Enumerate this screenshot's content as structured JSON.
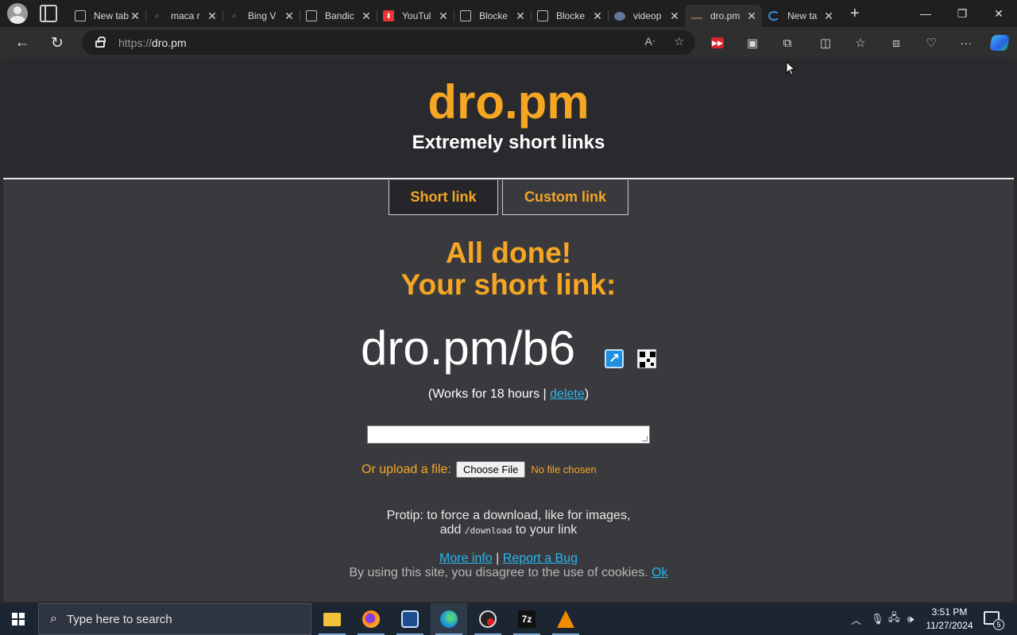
{
  "browser": {
    "tabs": [
      {
        "title": "New tab",
        "favicon": "doc-icon"
      },
      {
        "title": "maca r",
        "favicon": "search-icon"
      },
      {
        "title": "Bing V",
        "favicon": "search-icon"
      },
      {
        "title": "Bandic",
        "favicon": "doc-icon"
      },
      {
        "title": "YouTul",
        "favicon": "youtube-download-icon"
      },
      {
        "title": "Blocke",
        "favicon": "doc-icon"
      },
      {
        "title": "Blocke",
        "favicon": "doc-icon"
      },
      {
        "title": "videop",
        "favicon": "globe-icon"
      },
      {
        "title": "dro.pm",
        "favicon": "dro-icon",
        "active": true
      },
      {
        "title": "New ta",
        "favicon": "loading-icon"
      }
    ],
    "url_scheme": "https://",
    "url_host": "dro.pm"
  },
  "site": {
    "logo": "dro.pm",
    "tagline": "Extremely short links",
    "tabs": {
      "short": "Short link",
      "custom": "Custom link"
    },
    "done_line1": "All done!",
    "done_line2": "Your short link:",
    "short_link": "dro.pm/b6",
    "works_prefix": "(Works for 18 hours | ",
    "delete_label": "delete",
    "works_suffix": ")",
    "upload_label": "Or upload a file:",
    "choose_file": "Choose File",
    "no_file": "No file chosen",
    "protip_line1": "Protip: to force a download, like for images,",
    "protip_add": "add ",
    "protip_code": "/download",
    "protip_tail": " to your link",
    "more_info": "More info",
    "separator": " | ",
    "report_bug": "Report a Bug",
    "cookie_text": "By using this site, you disagree to the use of cookies. ",
    "cookie_ok": "Ok"
  },
  "taskbar": {
    "search_placeholder": "Type here to search",
    "time": "3:51 PM",
    "date": "11/27/2024",
    "notification_count": "5"
  },
  "colors": {
    "accent": "#f5a623",
    "link": "#27b7f0",
    "page_bg": "#3a3a3e",
    "header_bg": "#2a2a2e"
  }
}
